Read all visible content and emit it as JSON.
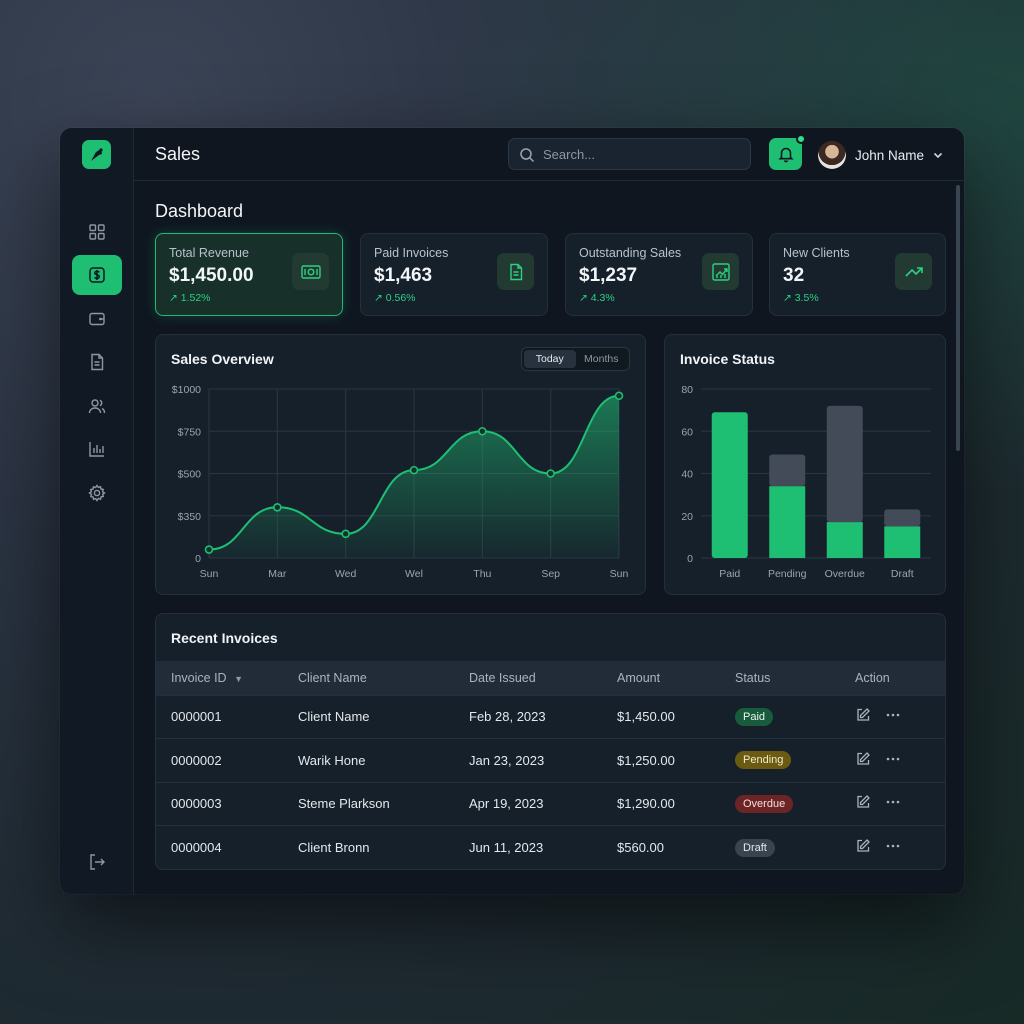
{
  "app": {
    "title": "Sales"
  },
  "search": {
    "placeholder": "Search..."
  },
  "user": {
    "name": "John Name"
  },
  "page": {
    "title": "Dashboard"
  },
  "stats": [
    {
      "label": "Total Revenue",
      "value": "$1,450.00",
      "delta": "1.52%",
      "icon": "cash-icon"
    },
    {
      "label": "Paid Invoices",
      "value": "$1,463",
      "delta": "0.56%",
      "icon": "document-icon"
    },
    {
      "label": "Outstanding Sales",
      "value": "$1,237",
      "delta": "4.3%",
      "icon": "chart-growth-icon"
    },
    {
      "label": "New Clients",
      "value": "32",
      "delta": "3.5%",
      "icon": "trend-up-icon"
    }
  ],
  "sales_overview": {
    "title": "Sales Overview",
    "toggle": [
      "Today",
      "Months"
    ],
    "active_toggle": "Today"
  },
  "invoice_status": {
    "title": "Invoice Status"
  },
  "chart_data": [
    {
      "type": "area",
      "title": "Sales Overview",
      "x": [
        "Sun",
        "Mar",
        "Wed",
        "Wel",
        "Thu",
        "Sep",
        "Sun"
      ],
      "y_ticks": [
        "0",
        "$350",
        "$500",
        "$750",
        "$1000"
      ],
      "values": [
        70,
        380,
        200,
        520,
        750,
        500,
        960
      ],
      "color": "#1fbf73",
      "grid": true
    },
    {
      "type": "bar",
      "title": "Invoice Status",
      "categories": [
        "Paid",
        "Pending",
        "Overdue",
        "Draft"
      ],
      "series": [
        {
          "values": [
            69,
            34,
            17,
            15
          ],
          "color": "#1fbf73"
        },
        {
          "values": [
            0,
            15,
            55,
            8
          ],
          "color": "#424b57"
        }
      ],
      "ylim": [
        0,
        80
      ],
      "y_ticks": [
        "0",
        "20",
        "40",
        "60",
        "80"
      ],
      "stacked": true,
      "grid": true
    }
  ],
  "invoices": {
    "title": "Recent Invoices",
    "columns": [
      "Invoice ID",
      "Client Name",
      "Date Issued",
      "Amount",
      "Status",
      "Action"
    ],
    "rows": [
      {
        "id": "0000001",
        "client": "Client Name",
        "date": "Feb 28, 2023",
        "amount": "$1,450.00",
        "status": "Paid"
      },
      {
        "id": "0000002",
        "client": "Warik Hone",
        "date": "Jan 23, 2023",
        "amount": "$1,250.00",
        "status": "Pending"
      },
      {
        "id": "0000003",
        "client": "Steme Plarkson",
        "date": "Apr 19, 2023",
        "amount": "$1,290.00",
        "status": "Overdue"
      },
      {
        "id": "0000004",
        "client": "Client Bronn",
        "date": "Jun 11, 2023",
        "amount": "$560.00",
        "status": "Draft"
      }
    ]
  },
  "status_colors": {
    "Paid": {
      "bg": "#185c3c",
      "fg": "#e8f6ee"
    },
    "Pending": {
      "bg": "#6b5a12",
      "fg": "#f3ecc9"
    },
    "Overdue": {
      "bg": "#6d2424",
      "fg": "#f5dede"
    },
    "Draft": {
      "bg": "#3a4450",
      "fg": "#e3e8ec"
    }
  },
  "accent": "#1fbf73"
}
